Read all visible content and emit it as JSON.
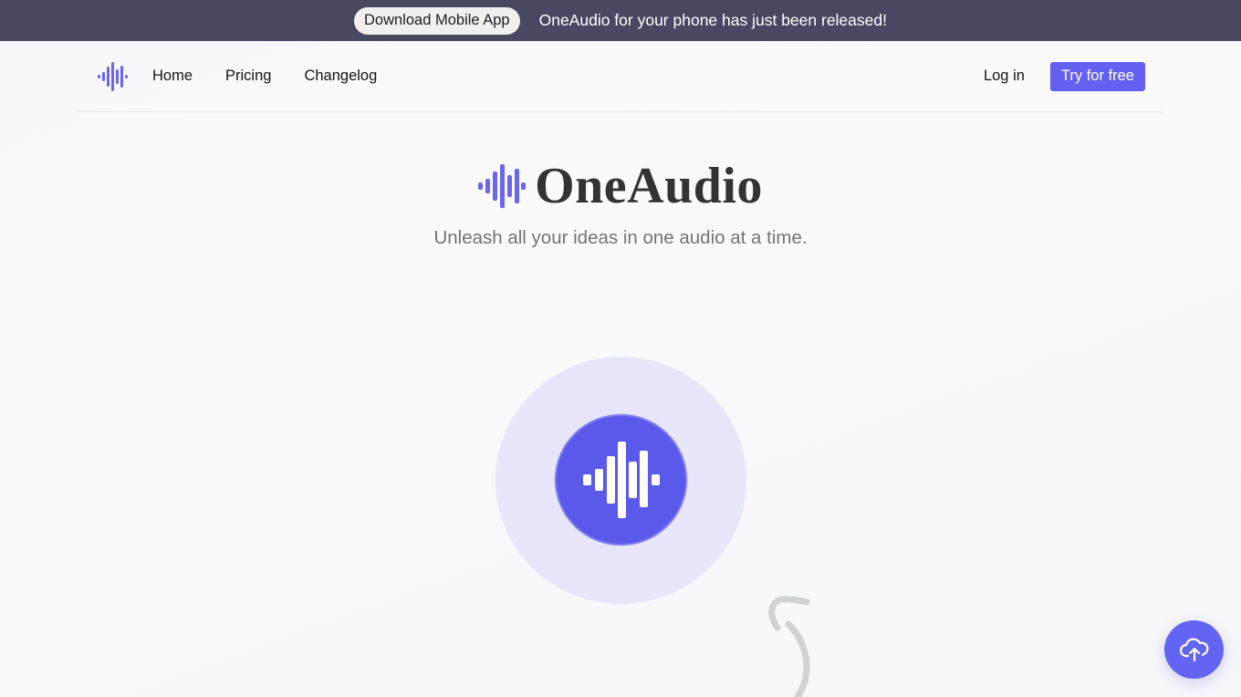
{
  "announcement": {
    "button_label": "Download Mobile App",
    "message": "OneAudio for your phone has just been released!"
  },
  "nav": {
    "logo_icon": "waveform-icon",
    "links": [
      {
        "label": "Home"
      },
      {
        "label": "Pricing"
      },
      {
        "label": "Changelog"
      }
    ],
    "login_label": "Log in",
    "cta_label": "Try for free"
  },
  "hero": {
    "title": "OneAudio",
    "tagline": "Unleash all your ideas in one audio at a time.",
    "logo_icon": "waveform-icon"
  },
  "record": {
    "icon": "waveform-icon"
  },
  "fab": {
    "icon": "cloud-upload-icon"
  },
  "colors": {
    "brand": "#6360f2",
    "announce_bg": "#484862",
    "record_bg": "#5b59e9",
    "record_halo": "#e7e6fb"
  }
}
